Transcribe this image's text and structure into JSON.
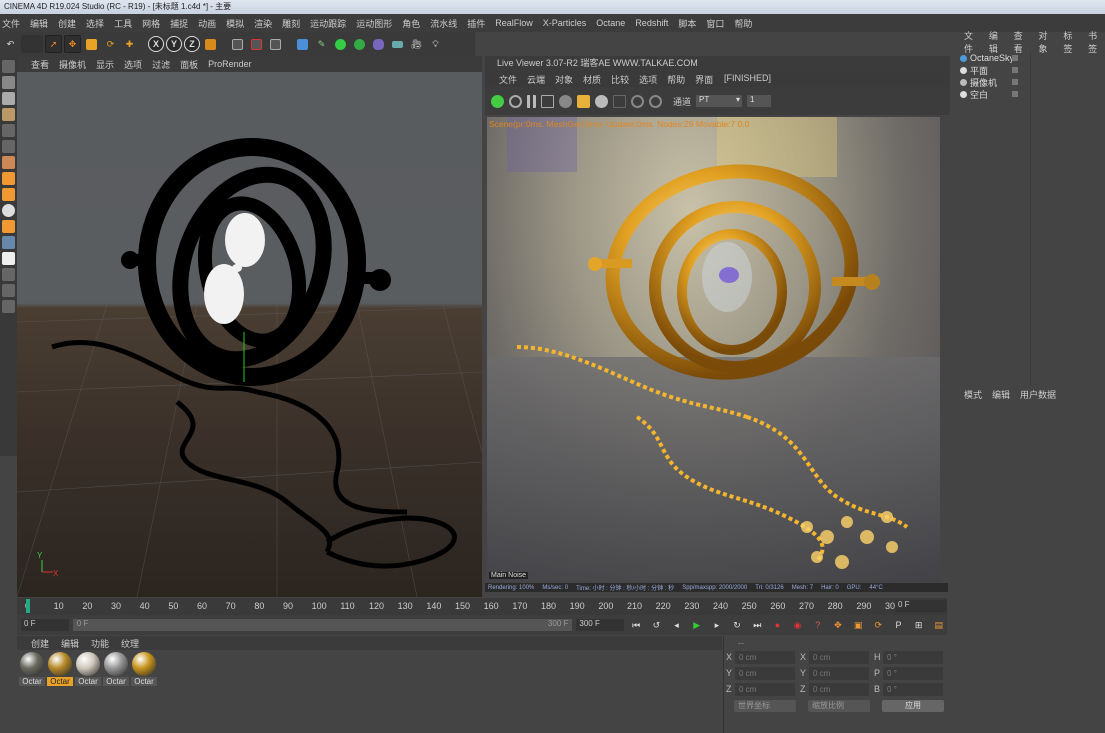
{
  "window": {
    "title": "CINEMA 4D R19.024 Studio (RC - R19) - [未标题 1.c4d *] - 主要"
  },
  "menu": [
    "文件",
    "编辑",
    "创建",
    "选择",
    "工具",
    "网格",
    "捕捉",
    "动画",
    "模拟",
    "渲染",
    "雕刻",
    "运动跟踪",
    "运动图形",
    "角色",
    "流水线",
    "插件",
    "RealFlow",
    "X-Particles",
    "Octane",
    "Redshift",
    "脚本",
    "窗口",
    "帮助"
  ],
  "toolbar": {
    "x_label": "X",
    "y_label": "Y",
    "z_label": "Z"
  },
  "viewport": {
    "menu": [
      "查看",
      "摄像机",
      "显示",
      "选项",
      "过滤",
      "面板",
      "ProRender"
    ],
    "axis_y": "Y",
    "axis_x": "X"
  },
  "live_viewer": {
    "title": "Live Viewer 3.07-R2 瑞客AE WWW.TALKAE.COM",
    "menu": [
      "文件",
      "云端",
      "对象",
      "材质",
      "比较",
      "选项",
      "帮助",
      "界面"
    ],
    "status": "[FINISHED]",
    "channel_label": "通道",
    "channel_value": "PT",
    "channel_num": "1",
    "overlay_text": "Scene(pr:0ms. MeshGen:0ms. Update:0ms. Nodes:29 Movable:7  0.0",
    "main_label": "Main",
    "noise_label": "Noise",
    "stats": [
      "Rendering: 100%",
      "Ms/sec: 0",
      "Time: 小时 : 分钟 : 秒/小时 : 分钟 : 秒",
      "Spp/maxspp: 2000/2000",
      "Tri: 0/3126",
      "Mesh: 7",
      "Hair: 0",
      "GPU:",
      "44°C"
    ]
  },
  "timeline": {
    "ticks": [
      "0",
      "10",
      "20",
      "30",
      "40",
      "50",
      "60",
      "70",
      "80",
      "90",
      "100",
      "110",
      "120",
      "130",
      "140",
      "150",
      "160",
      "170",
      "180",
      "190",
      "200",
      "210",
      "220",
      "230",
      "240",
      "250",
      "260",
      "270",
      "280",
      "290",
      "300"
    ],
    "current_frame": "0 F",
    "start_field": "0 F",
    "range_left": "0 F",
    "range_right": "300 F",
    "end_field": "300 F"
  },
  "materials": {
    "menu": [
      "创建",
      "编辑",
      "功能",
      "纹理"
    ],
    "items": [
      {
        "label": "Octar",
        "color": "#6a6a60"
      },
      {
        "label": "Octar",
        "color": "#b88a2a"
      },
      {
        "label": "Octar",
        "color": "#cfc9bd"
      },
      {
        "label": "Octar",
        "color": "#999999"
      },
      {
        "label": "Octar",
        "color": "#c8951e"
      }
    ]
  },
  "coords": {
    "rows": [
      {
        "a": "X",
        "av": "0 cm",
        "b": "X",
        "bv": "0 cm",
        "c": "H",
        "cv": "0 °"
      },
      {
        "a": "Y",
        "av": "0 cm",
        "b": "Y",
        "bv": "0 cm",
        "c": "P",
        "cv": "0 °"
      },
      {
        "a": "Z",
        "av": "0 cm",
        "b": "Z",
        "bv": "0 cm",
        "c": "B",
        "cv": "0 °"
      }
    ],
    "dropdown1": "世界坐标",
    "dropdown2": "缩放比例",
    "apply": "应用",
    "header": "--"
  },
  "object_manager": {
    "menu": [
      "文件",
      "编辑",
      "查看",
      "对象",
      "标签",
      "书签"
    ],
    "objects": [
      "OctaneSky",
      "平面",
      "摄像机",
      "空白"
    ]
  },
  "attributes": {
    "menu": [
      "模式",
      "编辑",
      "用户数据"
    ]
  },
  "colors": {
    "accent": "#e8b23a",
    "highlight": "#f29b1a",
    "active_bg": "#2f2f2f"
  }
}
